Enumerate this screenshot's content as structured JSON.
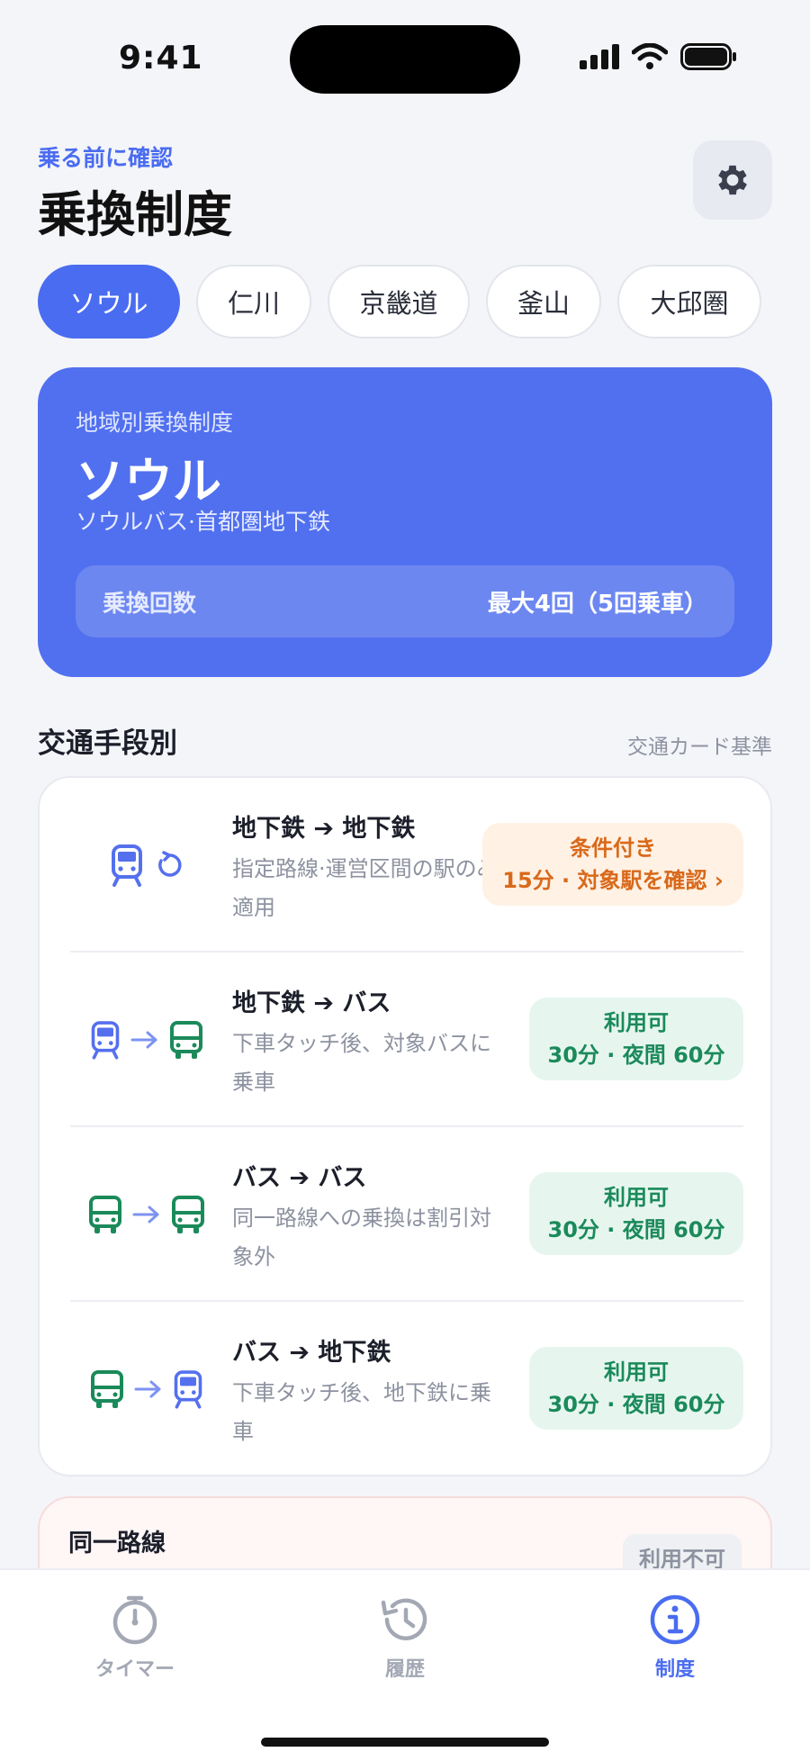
{
  "status_bar": {
    "time": "9:41"
  },
  "header": {
    "eyebrow": "乗る前に確認",
    "title": "乗換制度",
    "settings_icon": "gear-icon"
  },
  "tabs": [
    {
      "label": "ソウル",
      "active": true
    },
    {
      "label": "仁川",
      "active": false
    },
    {
      "label": "京畿道",
      "active": false
    },
    {
      "label": "釜山",
      "active": false
    },
    {
      "label": "大邱圏",
      "active": false
    }
  ],
  "hero": {
    "label": "地域別乗換制度",
    "region": "ソウル",
    "subtitle": "ソウルバス·首都圏地下鉄",
    "transfer_key": "乗換回数",
    "transfer_value": "最大4回（5回乗車）"
  },
  "section": {
    "title": "交通手段別",
    "note": "交通カード基準"
  },
  "transfers": [
    {
      "title": "地下鉄 ➔ 地下鉄",
      "description": "指定路線·運営区間の駅のみ適用",
      "status_line1": "条件付き",
      "status_line2": "15分 · 対象駅を確認 ›",
      "status_color": "#d9691a"
    },
    {
      "title": "地下鉄 ➔ バス",
      "description": "下車タッチ後、対象バスに乗車",
      "status_line1": "利用可",
      "status_line2": "30分 · 夜間 60分",
      "status_color": "#1b8a5a"
    },
    {
      "title": "バス ➔ バス",
      "description": "同一路線への乗換は割引対象外",
      "status_line1": "利用可",
      "status_line2": "30分 · 夜間 60分",
      "status_color": "#1b8a5a"
    },
    {
      "title": "バス ➔ 地下鉄",
      "description": "下車タッチ後、地下鉄に乗車",
      "status_line1": "利用可",
      "status_line2": "30分 · 夜間 60分",
      "status_color": "#1b8a5a"
    }
  ],
  "warning_card": {
    "title": "同一路線",
    "description": "",
    "status": "利用不可"
  },
  "bottom_nav": [
    {
      "label": "タイマー",
      "icon": "stopwatch-icon",
      "active": false
    },
    {
      "label": "履歴",
      "icon": "history-icon",
      "active": false
    },
    {
      "label": "制度",
      "icon": "info-icon",
      "active": true
    }
  ],
  "colors": {
    "accent": "#4a6cf0",
    "subway": "#5570ee",
    "bus": "#1b8a5a",
    "conditional": "#d9691a"
  }
}
